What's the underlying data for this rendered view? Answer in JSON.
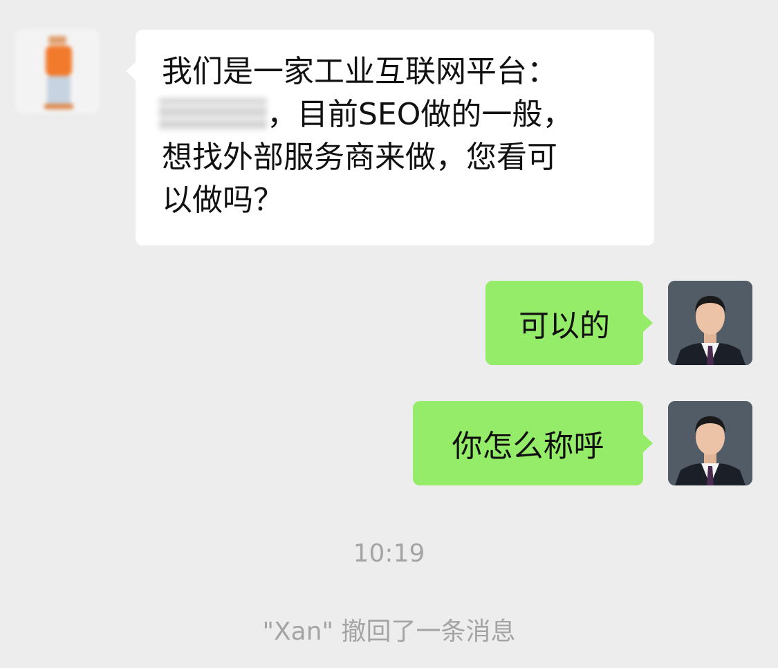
{
  "messages": [
    {
      "sender": "contact",
      "text_line1": "我们是一家工业互联网平台：",
      "text_line2_after_redaction": "，目前SEO做的一般，",
      "text_line3": "想找外部服务商来做，您看可",
      "text_line4": "以做吗？"
    },
    {
      "sender": "me",
      "text": "可以的"
    },
    {
      "sender": "me",
      "text": "你怎么称呼"
    }
  ],
  "timestamp": "10:19",
  "recall_notice": "\"Xan\" 撤回了一条消息",
  "colors": {
    "background": "#ededed",
    "incoming_bubble": "#ffffff",
    "outgoing_bubble": "#95ec69",
    "meta_text": "#a4a4a4"
  }
}
